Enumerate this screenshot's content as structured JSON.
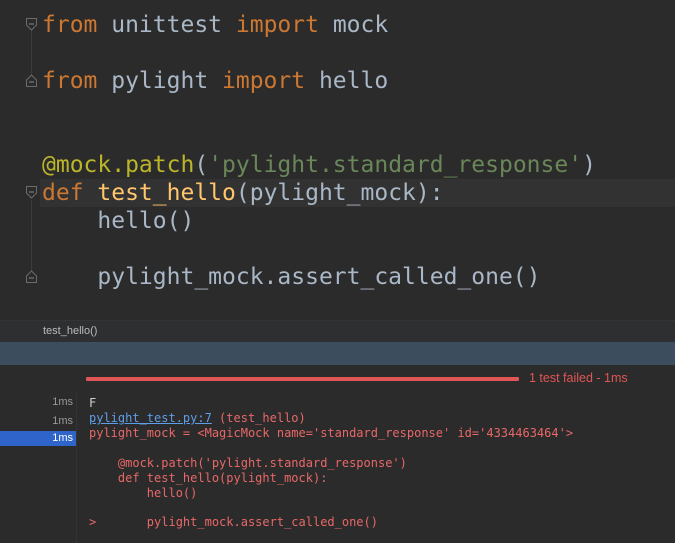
{
  "editor": {
    "line1": {
      "kw": "from",
      "mod": " unittest ",
      "kw2": "import",
      "name": " mock"
    },
    "line2": {
      "kw": "from",
      "mod": " pylight ",
      "kw2": "import",
      "name": " hello"
    },
    "line3": {
      "deco": "@mock.patch",
      "open": "(",
      "str": "'pylight.standard_response'",
      "close": ")"
    },
    "line4": {
      "kw": "def",
      "fn": " test_hello",
      "params": "(pylight_mock):"
    },
    "line5": "    hello()",
    "line6": "    pylight_mock.assert_called_one()"
  },
  "breadcrumb": {
    "label": "test_hello()"
  },
  "runner": {
    "status": "1 test failed - 1ms",
    "tree": [
      "1ms",
      "1ms",
      "1ms"
    ],
    "console": {
      "marker": "F",
      "link": "pylight_test.py:7",
      "link_suffix": " (test_hello)",
      "mock_repr": "pylight_mock = <MagicMock name='standard_response' id='4334463464'>",
      "src1": "    @mock.patch('pylight.standard_response')",
      "src2": "    def test_hello(pylight_mock):",
      "src3": "        hello()",
      "arrow_line": ">       pylight_mock.assert_called_one()"
    }
  },
  "colors": {
    "keyword": "#cc7832",
    "decorator": "#bbb529",
    "string": "#6a8759",
    "function": "#ffc66d",
    "error": "#e05555",
    "selection": "#2f65ca"
  }
}
